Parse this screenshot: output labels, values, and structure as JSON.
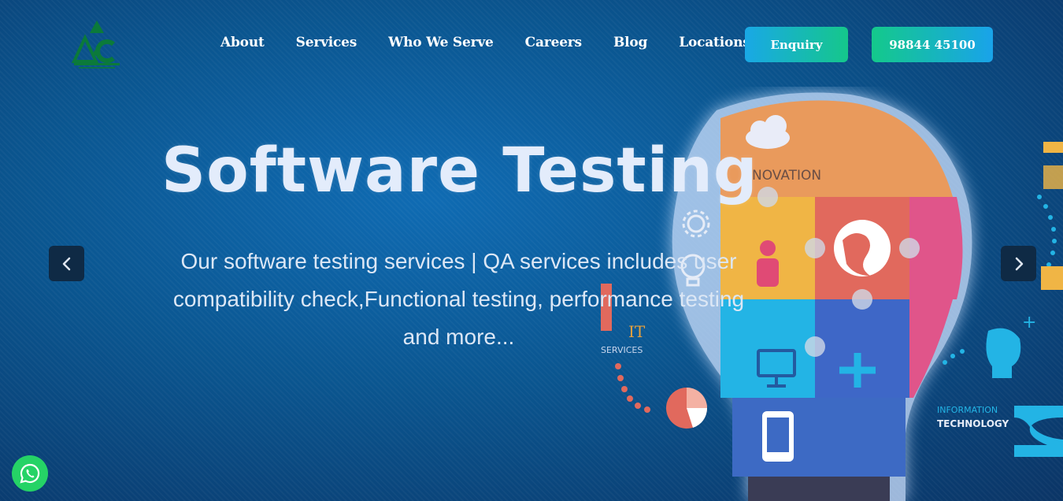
{
  "nav": {
    "items": [
      "About",
      "Services",
      "Who We Serve",
      "Careers",
      "Blog",
      "Locations"
    ]
  },
  "header": {
    "enquiry_label": "Enquiry",
    "phone_label": "98844 45100"
  },
  "hero": {
    "title": "Software Testing",
    "description": "Our software testing services | QA services includes user compatibility check,Functional testing, performance testing and more..."
  },
  "illustration": {
    "innovation_label": "NOVATION",
    "it_label": "IT",
    "services_label": "SERVICES",
    "information_label": "INFORMATION",
    "technology_label": "TECHNOLOGY"
  },
  "colors": {
    "accent_green": "#15c78b",
    "accent_blue": "#19a8e6",
    "whatsapp": "#25d366",
    "logo_green": "#0b7a3a"
  },
  "icons": {
    "prev": "chevron-left-icon",
    "next": "chevron-right-icon",
    "chat": "whatsapp-icon"
  }
}
